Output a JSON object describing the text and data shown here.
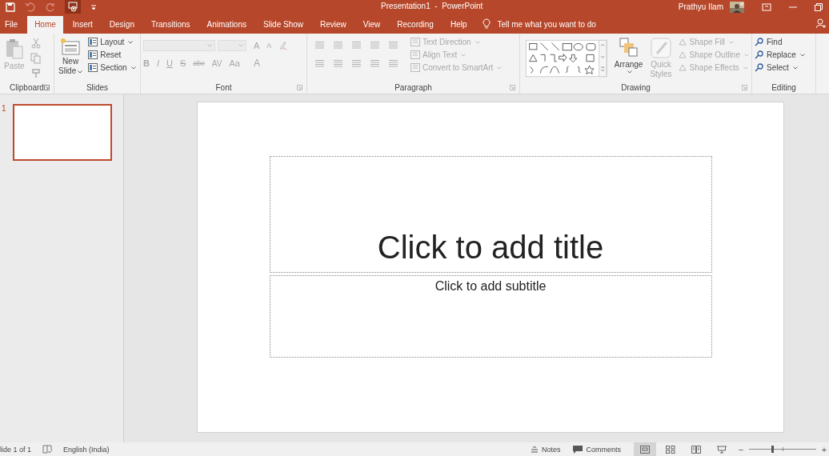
{
  "title_bar": {
    "title": "Presentation1  -  PowerPoint",
    "user": "Prathyu Ilam"
  },
  "tabs": [
    {
      "label": "File",
      "selected": false
    },
    {
      "label": "Home",
      "selected": true
    },
    {
      "label": "Insert",
      "selected": false
    },
    {
      "label": "Design",
      "selected": false
    },
    {
      "label": "Transitions",
      "selected": false
    },
    {
      "label": "Animations",
      "selected": false
    },
    {
      "label": "Slide Show",
      "selected": false
    },
    {
      "label": "Review",
      "selected": false
    },
    {
      "label": "View",
      "selected": false
    },
    {
      "label": "Recording",
      "selected": false
    },
    {
      "label": "Help",
      "selected": false
    }
  ],
  "tell_me": "Tell me what you want to do",
  "ribbon": {
    "clipboard": {
      "name": "Clipboard",
      "paste": "Paste",
      "disabled": true
    },
    "slides": {
      "name": "Slides",
      "new_slide": [
        "New",
        "Slide"
      ],
      "buttons": [
        {
          "label": "Layout",
          "dropdown": true
        },
        {
          "label": "Reset",
          "dropdown": false
        },
        {
          "label": "Section",
          "dropdown": true
        }
      ]
    },
    "font": {
      "name": "Font",
      "disabled": true,
      "row_1": [
        "A",
        "A"
      ],
      "row_2": [
        "B",
        "I",
        "U",
        "S",
        "abc",
        "AV",
        "Aa",
        "A"
      ]
    },
    "paragraph": {
      "name": "Paragraph",
      "disabled": true,
      "buttons": [
        {
          "label": "Text Direction",
          "dropdown": true
        },
        {
          "label": "Align Text",
          "dropdown": true
        },
        {
          "label": "Convert to SmartArt",
          "dropdown": true
        }
      ]
    },
    "drawing": {
      "name": "Drawing",
      "arrange": {
        "label": "Arrange",
        "disabled": false
      },
      "quick_styles": {
        "label": [
          "Quick",
          "Styles"
        ],
        "disabled": true
      },
      "buttons": [
        {
          "label": "Shape Fill",
          "disabled": true
        },
        {
          "label": "Shape Outline",
          "disabled": true
        },
        {
          "label": "Shape Effects",
          "disabled": true
        }
      ]
    },
    "editing": {
      "name": "Editing",
      "buttons": [
        {
          "label": "Find",
          "dropdown": false
        },
        {
          "label": "Replace",
          "dropdown": true
        },
        {
          "label": "Select",
          "dropdown": true
        }
      ]
    }
  },
  "thumbnails": [
    {
      "number": "1",
      "selected": true
    }
  ],
  "slide": {
    "title_placeholder": "Click to add title",
    "subtitle_placeholder": "Click to add subtitle"
  },
  "status_bar": {
    "slide_info": "lide 1 of 1",
    "language": "English (India)",
    "notes": "Notes",
    "comments": "Comments",
    "views": [
      {
        "kind": "normal",
        "selected": true
      },
      {
        "kind": "sorter",
        "selected": false
      },
      {
        "kind": "reading",
        "selected": false
      },
      {
        "kind": "slideshow",
        "selected": false
      }
    ],
    "zoom": {
      "minus": "−",
      "plus": "+",
      "level": 0.35
    }
  }
}
